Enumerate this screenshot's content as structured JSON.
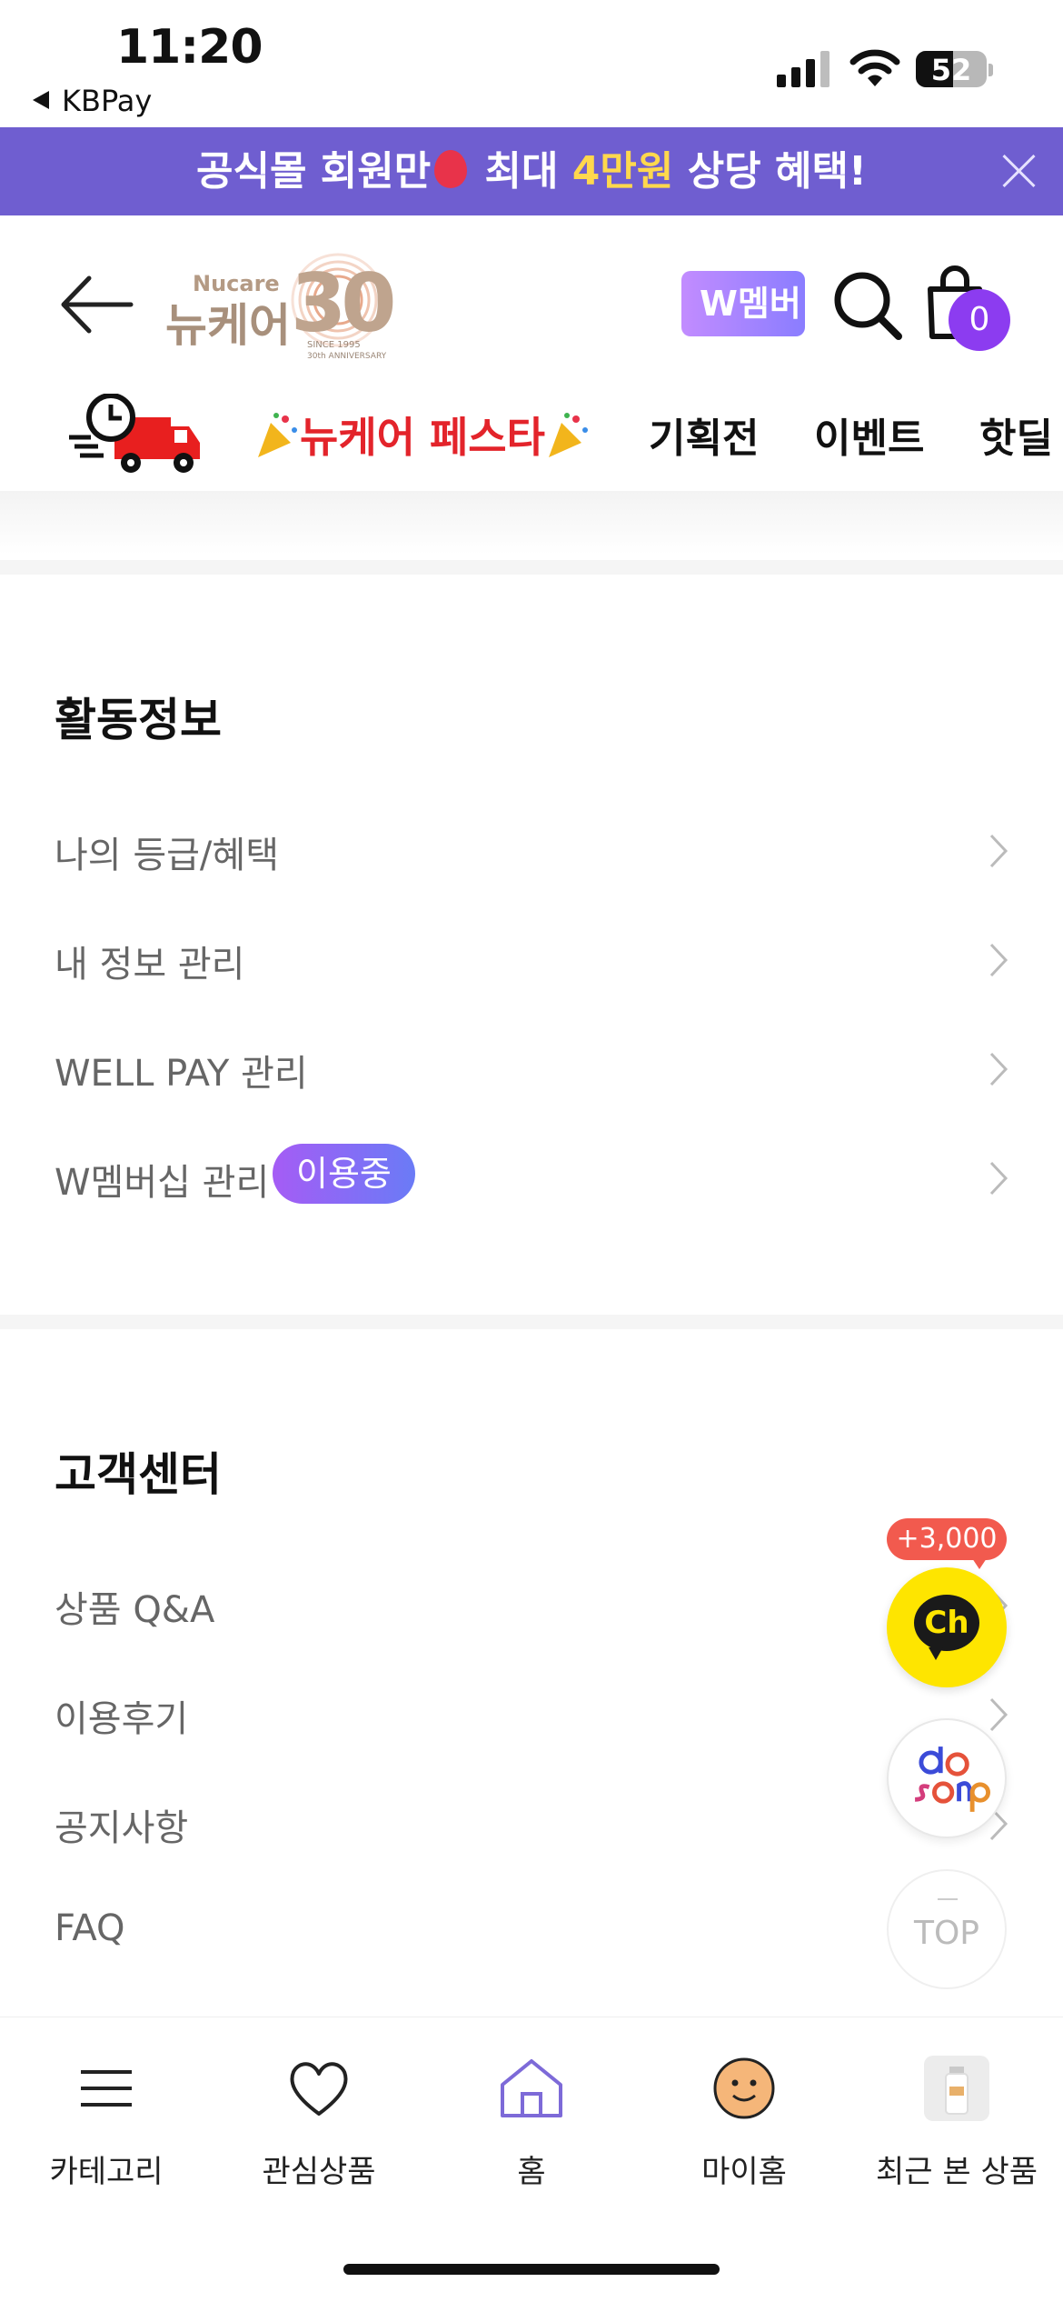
{
  "status_bar": {
    "time": "11:20",
    "back_app": "KBPay",
    "battery": "52",
    "battery_level": 0.52
  },
  "promo_banner": {
    "text_before": "공식몰 회원만",
    "text_mid": " 최대 ",
    "highlight": "4만원",
    "text_after": " 상당 혜택!",
    "highlight_color": "#ffd84d",
    "background_color": "#6f5ed0"
  },
  "header": {
    "logo_brand": "Nucare",
    "logo_korean": "뉴케어",
    "logo_number": "30",
    "logo_since": "SINCE 1995",
    "logo_anniv": "30th ANNIVERSARY",
    "membership_button": "W멤버",
    "cart_count": "0",
    "accent_color": "#8c3cf0"
  },
  "nav": {
    "festa": "뉴케어 페스타",
    "items": [
      "기획전",
      "이벤트",
      "핫딜"
    ]
  },
  "activity": {
    "title": "활동정보",
    "items": [
      "나의 등급/혜택",
      "내 정보 관리",
      "WELL PAY 관리",
      "W멤버십 관리"
    ],
    "membership_badge": "이용중"
  },
  "support": {
    "title": "고객센터",
    "items": [
      "상품 Q&A",
      "이용후기",
      "공지사항",
      "FAQ"
    ]
  },
  "floating": {
    "kakao_tag": "+3,000",
    "kakao_label": "Ch",
    "desamp_label": "desamp",
    "top_label": "TOP"
  },
  "tabbar": {
    "items": [
      {
        "label": "카테고리",
        "icon": "menu-icon"
      },
      {
        "label": "관심상품",
        "icon": "heart-icon"
      },
      {
        "label": "홈",
        "icon": "home-icon"
      },
      {
        "label": "마이홈",
        "icon": "smile-face-icon"
      },
      {
        "label": "최근 본 상품",
        "icon": "product-thumbnail-icon"
      }
    ]
  }
}
